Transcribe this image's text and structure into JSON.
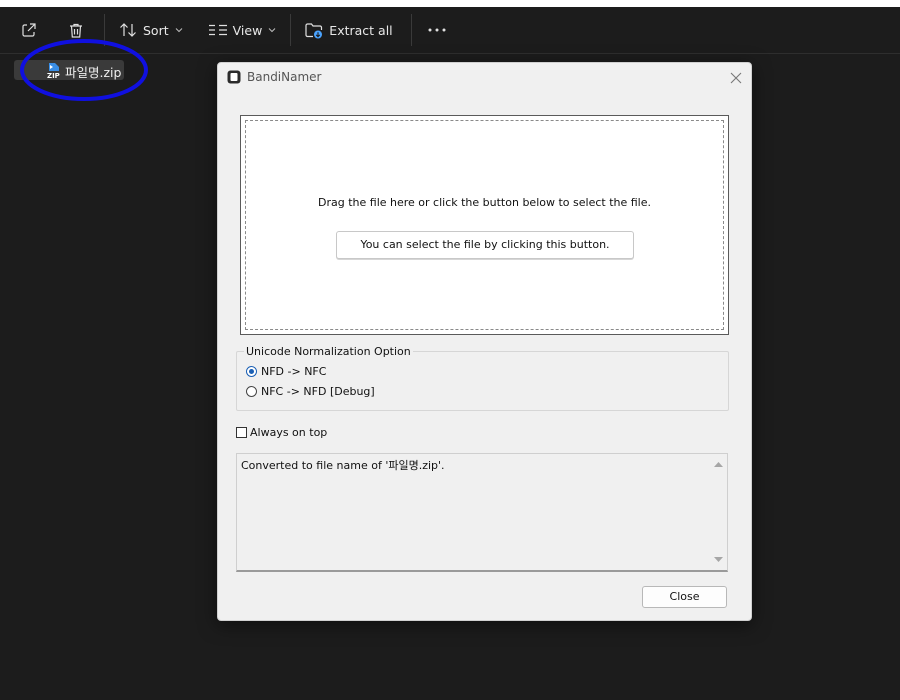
{
  "toolbar": {
    "share_icon": "share-icon",
    "delete_icon": "trash-icon",
    "sort_label": "Sort",
    "view_label": "View",
    "extract_label": "Extract all",
    "more_icon": "more-icon"
  },
  "file": {
    "name": "파일명.zip",
    "icon": "zip-file-icon"
  },
  "dialog": {
    "title": "BandiNamer",
    "drop_hint": "Drag the file here or click the button below to select the file.",
    "select_button": "You can select the file by clicking this button.",
    "group_title": "Unicode Normalization Option",
    "options": [
      {
        "label": "NFD -> NFC",
        "checked": true
      },
      {
        "label": "NFC -> NFD [Debug]",
        "checked": false
      }
    ],
    "always_on_top": {
      "label": "Always on top",
      "checked": false
    },
    "log_text": "Converted to file name of '파일명.zip'.",
    "close_button": "Close"
  },
  "colors": {
    "background": "#1c1c1c",
    "dialog_bg": "#f0f0f0",
    "annotation": "#1010e0",
    "radio_accent": "#1a5fb4"
  }
}
